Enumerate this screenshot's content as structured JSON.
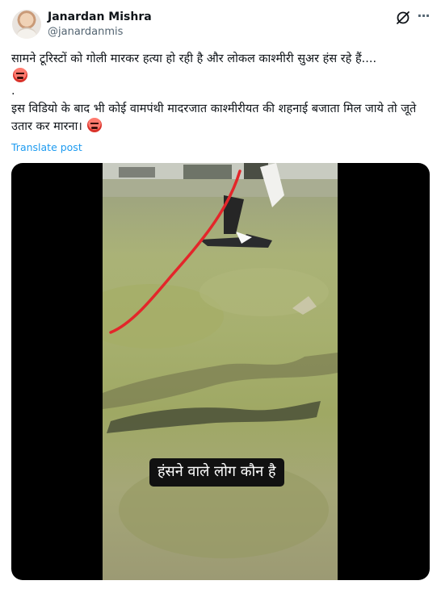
{
  "author": {
    "name": "Janardan Mishra",
    "handle": "@janardanmis"
  },
  "icons": {
    "grok": "grok-icon",
    "more": "more-icon",
    "emoji": "angry-face-emoji"
  },
  "tweet": {
    "line1": "सामने टूरिस्टों को गोली मारकर हत्या हो रही है और लोकल काश्मीरी सुअर हंस रहे हैं....",
    "dot": ".",
    "line2": "इस विडियो के बाद भी कोई वामपंथी मादरजात काश्मीरीयत की शहनाई बजाता मिल जाये तो जूते उतार कर मारना।",
    "translate_label": "Translate post"
  },
  "media": {
    "caption": "हंसने वाले लोग कौन है"
  },
  "colors": {
    "link": "#1d9bf0",
    "secondary_text": "#536471",
    "annotation_line": "#e3262a",
    "caption_bg": "#111111"
  }
}
